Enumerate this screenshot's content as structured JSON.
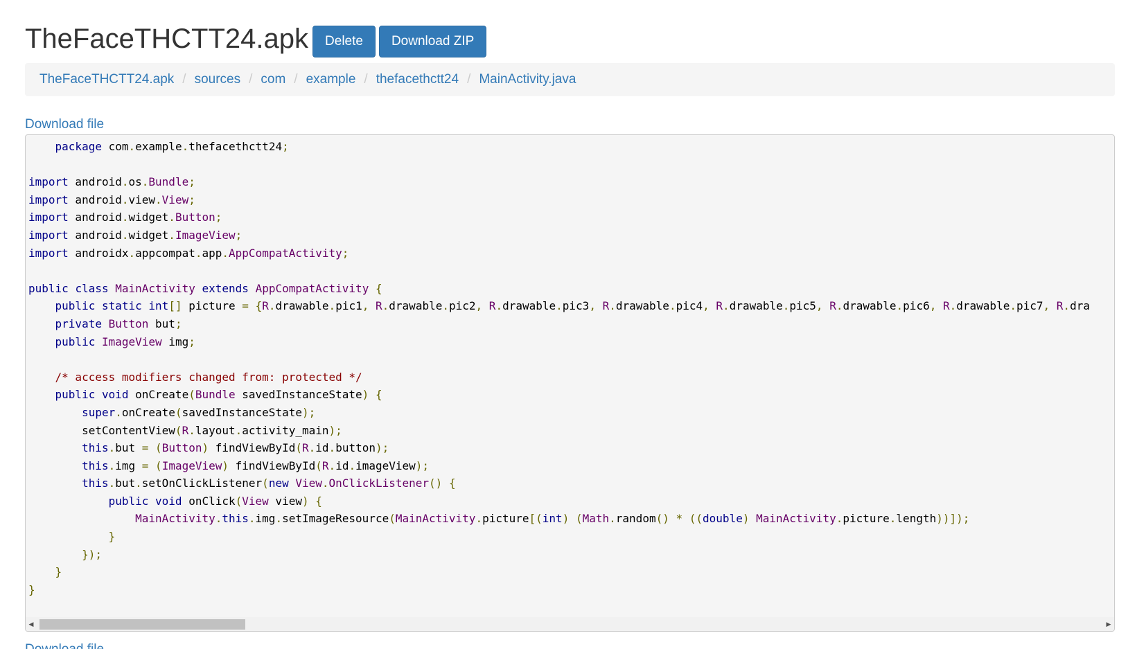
{
  "header": {
    "title": "TheFaceTHCTT24.apk",
    "delete_label": "Delete",
    "download_zip_label": "Download ZIP"
  },
  "breadcrumb": [
    "TheFaceTHCTT24.apk",
    "sources",
    "com",
    "example",
    "thefacethctt24",
    "MainActivity.java"
  ],
  "breadcrumb_separator": "/",
  "download_link": "Download file",
  "download_link_bottom": "Download file",
  "colors": {
    "link": "#337ab7",
    "button": "#337ab7",
    "keyword": "#000088",
    "type": "#660066",
    "punctuation": "#666600",
    "comment": "#880000"
  },
  "code_lines": [
    [
      [
        "    ",
        ""
      ],
      [
        "package",
        "kw"
      ],
      [
        " com",
        ""
      ],
      [
        ".",
        "pn"
      ],
      [
        "example",
        ""
      ],
      [
        ".",
        "pn"
      ],
      [
        "thefacethctt24",
        ""
      ],
      [
        ";",
        "pn"
      ]
    ],
    [],
    [
      [
        "import",
        "kw"
      ],
      [
        " android",
        ""
      ],
      [
        ".",
        "pn"
      ],
      [
        "os",
        ""
      ],
      [
        ".",
        "pn"
      ],
      [
        "Bundle",
        "ty"
      ],
      [
        ";",
        "pn"
      ]
    ],
    [
      [
        "import",
        "kw"
      ],
      [
        " android",
        ""
      ],
      [
        ".",
        "pn"
      ],
      [
        "view",
        ""
      ],
      [
        ".",
        "pn"
      ],
      [
        "View",
        "ty"
      ],
      [
        ";",
        "pn"
      ]
    ],
    [
      [
        "import",
        "kw"
      ],
      [
        " android",
        ""
      ],
      [
        ".",
        "pn"
      ],
      [
        "widget",
        ""
      ],
      [
        ".",
        "pn"
      ],
      [
        "Button",
        "ty"
      ],
      [
        ";",
        "pn"
      ]
    ],
    [
      [
        "import",
        "kw"
      ],
      [
        " android",
        ""
      ],
      [
        ".",
        "pn"
      ],
      [
        "widget",
        ""
      ],
      [
        ".",
        "pn"
      ],
      [
        "ImageView",
        "ty"
      ],
      [
        ";",
        "pn"
      ]
    ],
    [
      [
        "import",
        "kw"
      ],
      [
        " androidx",
        ""
      ],
      [
        ".",
        "pn"
      ],
      [
        "appcompat",
        ""
      ],
      [
        ".",
        "pn"
      ],
      [
        "app",
        ""
      ],
      [
        ".",
        "pn"
      ],
      [
        "AppCompatActivity",
        "ty"
      ],
      [
        ";",
        "pn"
      ]
    ],
    [],
    [
      [
        "public",
        "kw"
      ],
      [
        " ",
        ""
      ],
      [
        "class",
        "kw"
      ],
      [
        " ",
        ""
      ],
      [
        "MainActivity",
        "ty"
      ],
      [
        " ",
        ""
      ],
      [
        "extends",
        "kw"
      ],
      [
        " ",
        ""
      ],
      [
        "AppCompatActivity",
        "ty"
      ],
      [
        " ",
        ""
      ],
      [
        "{",
        "pn"
      ]
    ],
    [
      [
        "    ",
        ""
      ],
      [
        "public",
        "kw"
      ],
      [
        " ",
        ""
      ],
      [
        "static",
        "kw"
      ],
      [
        " ",
        ""
      ],
      [
        "int",
        "kw"
      ],
      [
        "[]",
        "pn"
      ],
      [
        " picture ",
        ""
      ],
      [
        "=",
        "pn"
      ],
      [
        " ",
        ""
      ],
      [
        "{",
        "pn"
      ],
      [
        "R",
        "ty"
      ],
      [
        ".",
        "pn"
      ],
      [
        "drawable",
        ""
      ],
      [
        ".",
        "pn"
      ],
      [
        "pic1",
        ""
      ],
      [
        ",",
        "pn"
      ],
      [
        " ",
        ""
      ],
      [
        "R",
        "ty"
      ],
      [
        ".",
        "pn"
      ],
      [
        "drawable",
        ""
      ],
      [
        ".",
        "pn"
      ],
      [
        "pic2",
        ""
      ],
      [
        ",",
        "pn"
      ],
      [
        " ",
        ""
      ],
      [
        "R",
        "ty"
      ],
      [
        ".",
        "pn"
      ],
      [
        "drawable",
        ""
      ],
      [
        ".",
        "pn"
      ],
      [
        "pic3",
        ""
      ],
      [
        ",",
        "pn"
      ],
      [
        " ",
        ""
      ],
      [
        "R",
        "ty"
      ],
      [
        ".",
        "pn"
      ],
      [
        "drawable",
        ""
      ],
      [
        ".",
        "pn"
      ],
      [
        "pic4",
        ""
      ],
      [
        ",",
        "pn"
      ],
      [
        " ",
        ""
      ],
      [
        "R",
        "ty"
      ],
      [
        ".",
        "pn"
      ],
      [
        "drawable",
        ""
      ],
      [
        ".",
        "pn"
      ],
      [
        "pic5",
        ""
      ],
      [
        ",",
        "pn"
      ],
      [
        " ",
        ""
      ],
      [
        "R",
        "ty"
      ],
      [
        ".",
        "pn"
      ],
      [
        "drawable",
        ""
      ],
      [
        ".",
        "pn"
      ],
      [
        "pic6",
        ""
      ],
      [
        ",",
        "pn"
      ],
      [
        " ",
        ""
      ],
      [
        "R",
        "ty"
      ],
      [
        ".",
        "pn"
      ],
      [
        "drawable",
        ""
      ],
      [
        ".",
        "pn"
      ],
      [
        "pic7",
        ""
      ],
      [
        ",",
        "pn"
      ],
      [
        " ",
        ""
      ],
      [
        "R",
        "ty"
      ],
      [
        ".",
        "pn"
      ],
      [
        "dra",
        ""
      ]
    ],
    [
      [
        "    ",
        ""
      ],
      [
        "private",
        "kw"
      ],
      [
        " ",
        ""
      ],
      [
        "Button",
        "ty"
      ],
      [
        " but",
        ""
      ],
      [
        ";",
        "pn"
      ]
    ],
    [
      [
        "    ",
        ""
      ],
      [
        "public",
        "kw"
      ],
      [
        " ",
        ""
      ],
      [
        "ImageView",
        "ty"
      ],
      [
        " img",
        ""
      ],
      [
        ";",
        "pn"
      ]
    ],
    [],
    [
      [
        "    ",
        ""
      ],
      [
        "/* access modifiers changed from: protected */",
        "cm"
      ]
    ],
    [
      [
        "    ",
        ""
      ],
      [
        "public",
        "kw"
      ],
      [
        " ",
        ""
      ],
      [
        "void",
        "kw"
      ],
      [
        " onCreate",
        ""
      ],
      [
        "(",
        "pn"
      ],
      [
        "Bundle",
        "ty"
      ],
      [
        " savedInstanceState",
        ""
      ],
      [
        ")",
        "pn"
      ],
      [
        " ",
        ""
      ],
      [
        "{",
        "pn"
      ]
    ],
    [
      [
        "        ",
        ""
      ],
      [
        "super",
        "kw"
      ],
      [
        ".",
        "pn"
      ],
      [
        "onCreate",
        ""
      ],
      [
        "(",
        "pn"
      ],
      [
        "savedInstanceState",
        ""
      ],
      [
        ");",
        "pn"
      ]
    ],
    [
      [
        "        ",
        ""
      ],
      [
        "setContentView",
        ""
      ],
      [
        "(",
        "pn"
      ],
      [
        "R",
        "ty"
      ],
      [
        ".",
        "pn"
      ],
      [
        "layout",
        ""
      ],
      [
        ".",
        "pn"
      ],
      [
        "activity_main",
        ""
      ],
      [
        ");",
        "pn"
      ]
    ],
    [
      [
        "        ",
        ""
      ],
      [
        "this",
        "kw"
      ],
      [
        ".",
        "pn"
      ],
      [
        "but ",
        ""
      ],
      [
        "=",
        "pn"
      ],
      [
        " ",
        ""
      ],
      [
        "(",
        "pn"
      ],
      [
        "Button",
        "ty"
      ],
      [
        ")",
        "pn"
      ],
      [
        " findViewById",
        ""
      ],
      [
        "(",
        "pn"
      ],
      [
        "R",
        "ty"
      ],
      [
        ".",
        "pn"
      ],
      [
        "id",
        ""
      ],
      [
        ".",
        "pn"
      ],
      [
        "button",
        ""
      ],
      [
        ");",
        "pn"
      ]
    ],
    [
      [
        "        ",
        ""
      ],
      [
        "this",
        "kw"
      ],
      [
        ".",
        "pn"
      ],
      [
        "img ",
        ""
      ],
      [
        "=",
        "pn"
      ],
      [
        " ",
        ""
      ],
      [
        "(",
        "pn"
      ],
      [
        "ImageView",
        "ty"
      ],
      [
        ")",
        "pn"
      ],
      [
        " findViewById",
        ""
      ],
      [
        "(",
        "pn"
      ],
      [
        "R",
        "ty"
      ],
      [
        ".",
        "pn"
      ],
      [
        "id",
        ""
      ],
      [
        ".",
        "pn"
      ],
      [
        "imageView",
        ""
      ],
      [
        ");",
        "pn"
      ]
    ],
    [
      [
        "        ",
        ""
      ],
      [
        "this",
        "kw"
      ],
      [
        ".",
        "pn"
      ],
      [
        "but",
        ""
      ],
      [
        ".",
        "pn"
      ],
      [
        "setOnClickListener",
        ""
      ],
      [
        "(",
        "pn"
      ],
      [
        "new",
        "kw"
      ],
      [
        " ",
        ""
      ],
      [
        "View",
        "ty"
      ],
      [
        ".",
        "pn"
      ],
      [
        "OnClickListener",
        "ty"
      ],
      [
        "()",
        "pn"
      ],
      [
        " ",
        ""
      ],
      [
        "{",
        "pn"
      ]
    ],
    [
      [
        "            ",
        ""
      ],
      [
        "public",
        "kw"
      ],
      [
        " ",
        ""
      ],
      [
        "void",
        "kw"
      ],
      [
        " onClick",
        ""
      ],
      [
        "(",
        "pn"
      ],
      [
        "View",
        "ty"
      ],
      [
        " view",
        ""
      ],
      [
        ")",
        "pn"
      ],
      [
        " ",
        ""
      ],
      [
        "{",
        "pn"
      ]
    ],
    [
      [
        "                ",
        ""
      ],
      [
        "MainActivity",
        "ty"
      ],
      [
        ".",
        "pn"
      ],
      [
        "this",
        "kw"
      ],
      [
        ".",
        "pn"
      ],
      [
        "img",
        ""
      ],
      [
        ".",
        "pn"
      ],
      [
        "setImageResource",
        ""
      ],
      [
        "(",
        "pn"
      ],
      [
        "MainActivity",
        "ty"
      ],
      [
        ".",
        "pn"
      ],
      [
        "picture",
        ""
      ],
      [
        "[(",
        "pn"
      ],
      [
        "int",
        "kw"
      ],
      [
        ")",
        "pn"
      ],
      [
        " ",
        ""
      ],
      [
        "(",
        "pn"
      ],
      [
        "Math",
        "ty"
      ],
      [
        ".",
        "pn"
      ],
      [
        "random",
        ""
      ],
      [
        "()",
        "pn"
      ],
      [
        " ",
        ""
      ],
      [
        "*",
        "pn"
      ],
      [
        " ",
        ""
      ],
      [
        "((",
        "pn"
      ],
      [
        "double",
        "kw"
      ],
      [
        ")",
        "pn"
      ],
      [
        " ",
        ""
      ],
      [
        "MainActivity",
        "ty"
      ],
      [
        ".",
        "pn"
      ],
      [
        "picture",
        ""
      ],
      [
        ".",
        "pn"
      ],
      [
        "length",
        ""
      ],
      [
        "))]);",
        "pn"
      ]
    ],
    [
      [
        "            ",
        ""
      ],
      [
        "}",
        "pn"
      ]
    ],
    [
      [
        "        ",
        ""
      ],
      [
        "});",
        "pn"
      ]
    ],
    [
      [
        "    ",
        ""
      ],
      [
        "}",
        "pn"
      ]
    ],
    [
      [
        "}",
        "pn"
      ]
    ]
  ]
}
